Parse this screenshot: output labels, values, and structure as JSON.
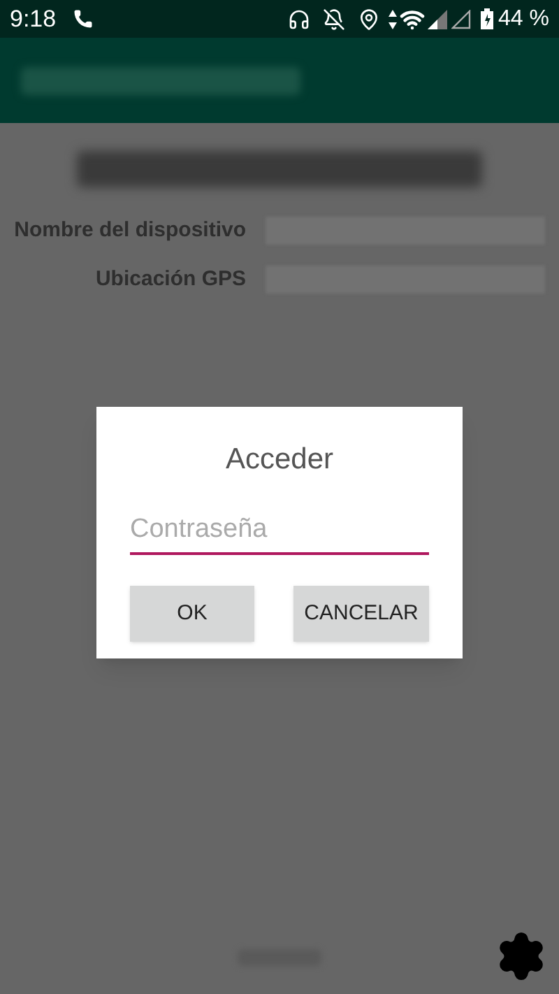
{
  "status_bar": {
    "time": "9:18",
    "battery": "44 %"
  },
  "form": {
    "fields": [
      {
        "label": "Nombre del dispositivo"
      },
      {
        "label": "Ubicación GPS"
      }
    ]
  },
  "dialog": {
    "title": "Acceder",
    "password": {
      "placeholder": "Contraseña"
    },
    "buttons": [
      "OK",
      "CANCELAR"
    ]
  }
}
